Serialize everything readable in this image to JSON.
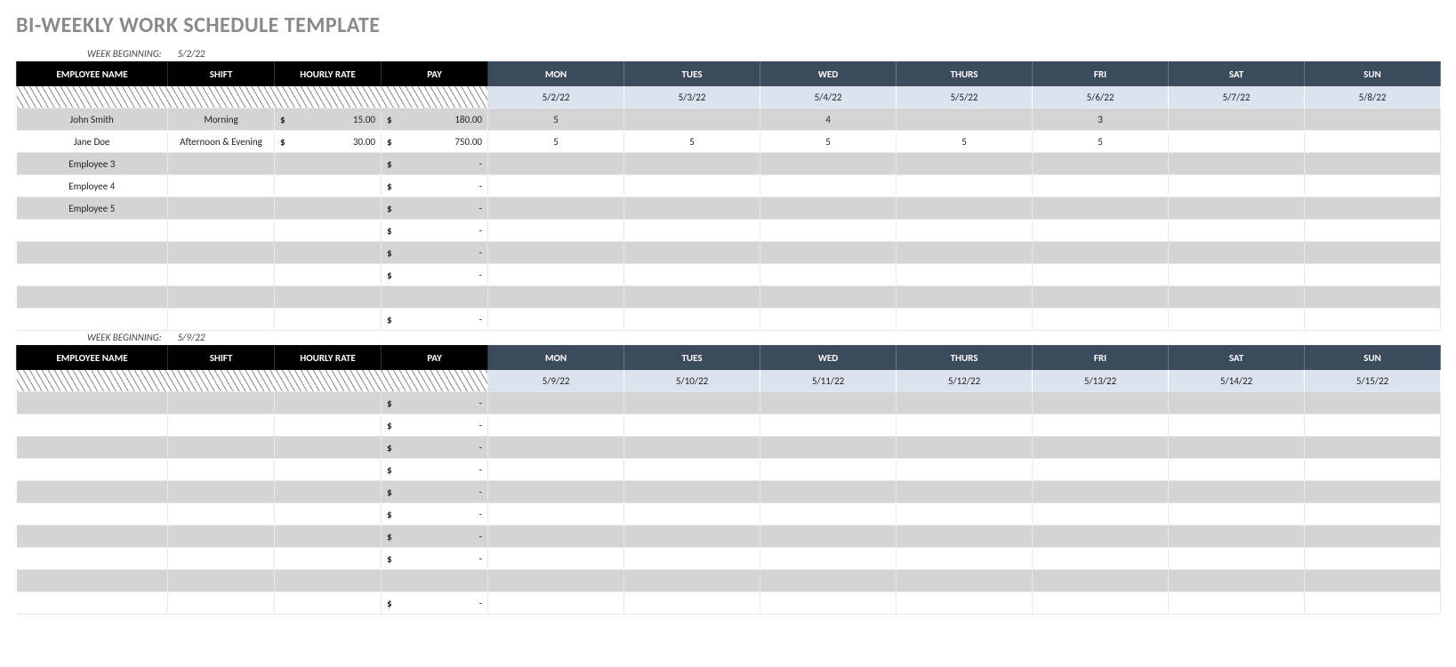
{
  "title": "BI-WEEKLY WORK SCHEDULE TEMPLATE",
  "labels": {
    "week_beginning": "WEEK BEGINNING:",
    "employee_name": "EMPLOYEE NAME",
    "shift": "SHIFT",
    "hourly_rate": "HOURLY RATE",
    "pay": "PAY",
    "currency": "$",
    "dash": "-"
  },
  "days": [
    "MON",
    "TUES",
    "WED",
    "THURS",
    "FRI",
    "SAT",
    "SUN"
  ],
  "weeks": [
    {
      "beginning": "5/2/22",
      "dates": [
        "5/2/22",
        "5/3/22",
        "5/4/22",
        "5/5/22",
        "5/6/22",
        "5/7/22",
        "5/8/22"
      ],
      "rows": [
        {
          "name": "John Smith",
          "shift": "Morning",
          "rate": "15.00",
          "pay": "180.00",
          "hours": [
            "5",
            "",
            "4",
            "",
            "3",
            "",
            ""
          ]
        },
        {
          "name": "Jane Doe",
          "shift": "Afternoon & Evening",
          "rate": "30.00",
          "pay": "750.00",
          "hours": [
            "5",
            "5",
            "5",
            "5",
            "5",
            "",
            ""
          ]
        },
        {
          "name": "Employee 3",
          "shift": "",
          "rate": "",
          "pay": "-",
          "hours": [
            "",
            "",
            "",
            "",
            "",
            "",
            ""
          ]
        },
        {
          "name": "Employee 4",
          "shift": "",
          "rate": "",
          "pay": "-",
          "hours": [
            "",
            "",
            "",
            "",
            "",
            "",
            ""
          ]
        },
        {
          "name": "Employee 5",
          "shift": "",
          "rate": "",
          "pay": "-",
          "hours": [
            "",
            "",
            "",
            "",
            "",
            "",
            ""
          ]
        },
        {
          "name": "",
          "shift": "",
          "rate": "",
          "pay": "-",
          "hours": [
            "",
            "",
            "",
            "",
            "",
            "",
            ""
          ]
        },
        {
          "name": "",
          "shift": "",
          "rate": "",
          "pay": "-",
          "hours": [
            "",
            "",
            "",
            "",
            "",
            "",
            ""
          ]
        },
        {
          "name": "",
          "shift": "",
          "rate": "",
          "pay": "-",
          "hours": [
            "",
            "",
            "",
            "",
            "",
            "",
            ""
          ]
        },
        {
          "name": "",
          "shift": "",
          "rate": "",
          "pay": "",
          "hours": [
            "",
            "",
            "",
            "",
            "",
            "",
            ""
          ]
        },
        {
          "name": "",
          "shift": "",
          "rate": "",
          "pay": "-",
          "hours": [
            "",
            "",
            "",
            "",
            "",
            "",
            ""
          ]
        }
      ]
    },
    {
      "beginning": "5/9/22",
      "dates": [
        "5/9/22",
        "5/10/22",
        "5/11/22",
        "5/12/22",
        "5/13/22",
        "5/14/22",
        "5/15/22"
      ],
      "rows": [
        {
          "name": "",
          "shift": "",
          "rate": "",
          "pay": "-",
          "hours": [
            "",
            "",
            "",
            "",
            "",
            "",
            ""
          ]
        },
        {
          "name": "",
          "shift": "",
          "rate": "",
          "pay": "-",
          "hours": [
            "",
            "",
            "",
            "",
            "",
            "",
            ""
          ]
        },
        {
          "name": "",
          "shift": "",
          "rate": "",
          "pay": "-",
          "hours": [
            "",
            "",
            "",
            "",
            "",
            "",
            ""
          ]
        },
        {
          "name": "",
          "shift": "",
          "rate": "",
          "pay": "-",
          "hours": [
            "",
            "",
            "",
            "",
            "",
            "",
            ""
          ]
        },
        {
          "name": "",
          "shift": "",
          "rate": "",
          "pay": "-",
          "hours": [
            "",
            "",
            "",
            "",
            "",
            "",
            ""
          ]
        },
        {
          "name": "",
          "shift": "",
          "rate": "",
          "pay": "-",
          "hours": [
            "",
            "",
            "",
            "",
            "",
            "",
            ""
          ]
        },
        {
          "name": "",
          "shift": "",
          "rate": "",
          "pay": "-",
          "hours": [
            "",
            "",
            "",
            "",
            "",
            "",
            ""
          ]
        },
        {
          "name": "",
          "shift": "",
          "rate": "",
          "pay": "-",
          "hours": [
            "",
            "",
            "",
            "",
            "",
            "",
            ""
          ]
        },
        {
          "name": "",
          "shift": "",
          "rate": "",
          "pay": "",
          "hours": [
            "",
            "",
            "",
            "",
            "",
            "",
            ""
          ]
        },
        {
          "name": "",
          "shift": "",
          "rate": "",
          "pay": "-",
          "hours": [
            "",
            "",
            "",
            "",
            "",
            "",
            ""
          ]
        }
      ]
    }
  ]
}
